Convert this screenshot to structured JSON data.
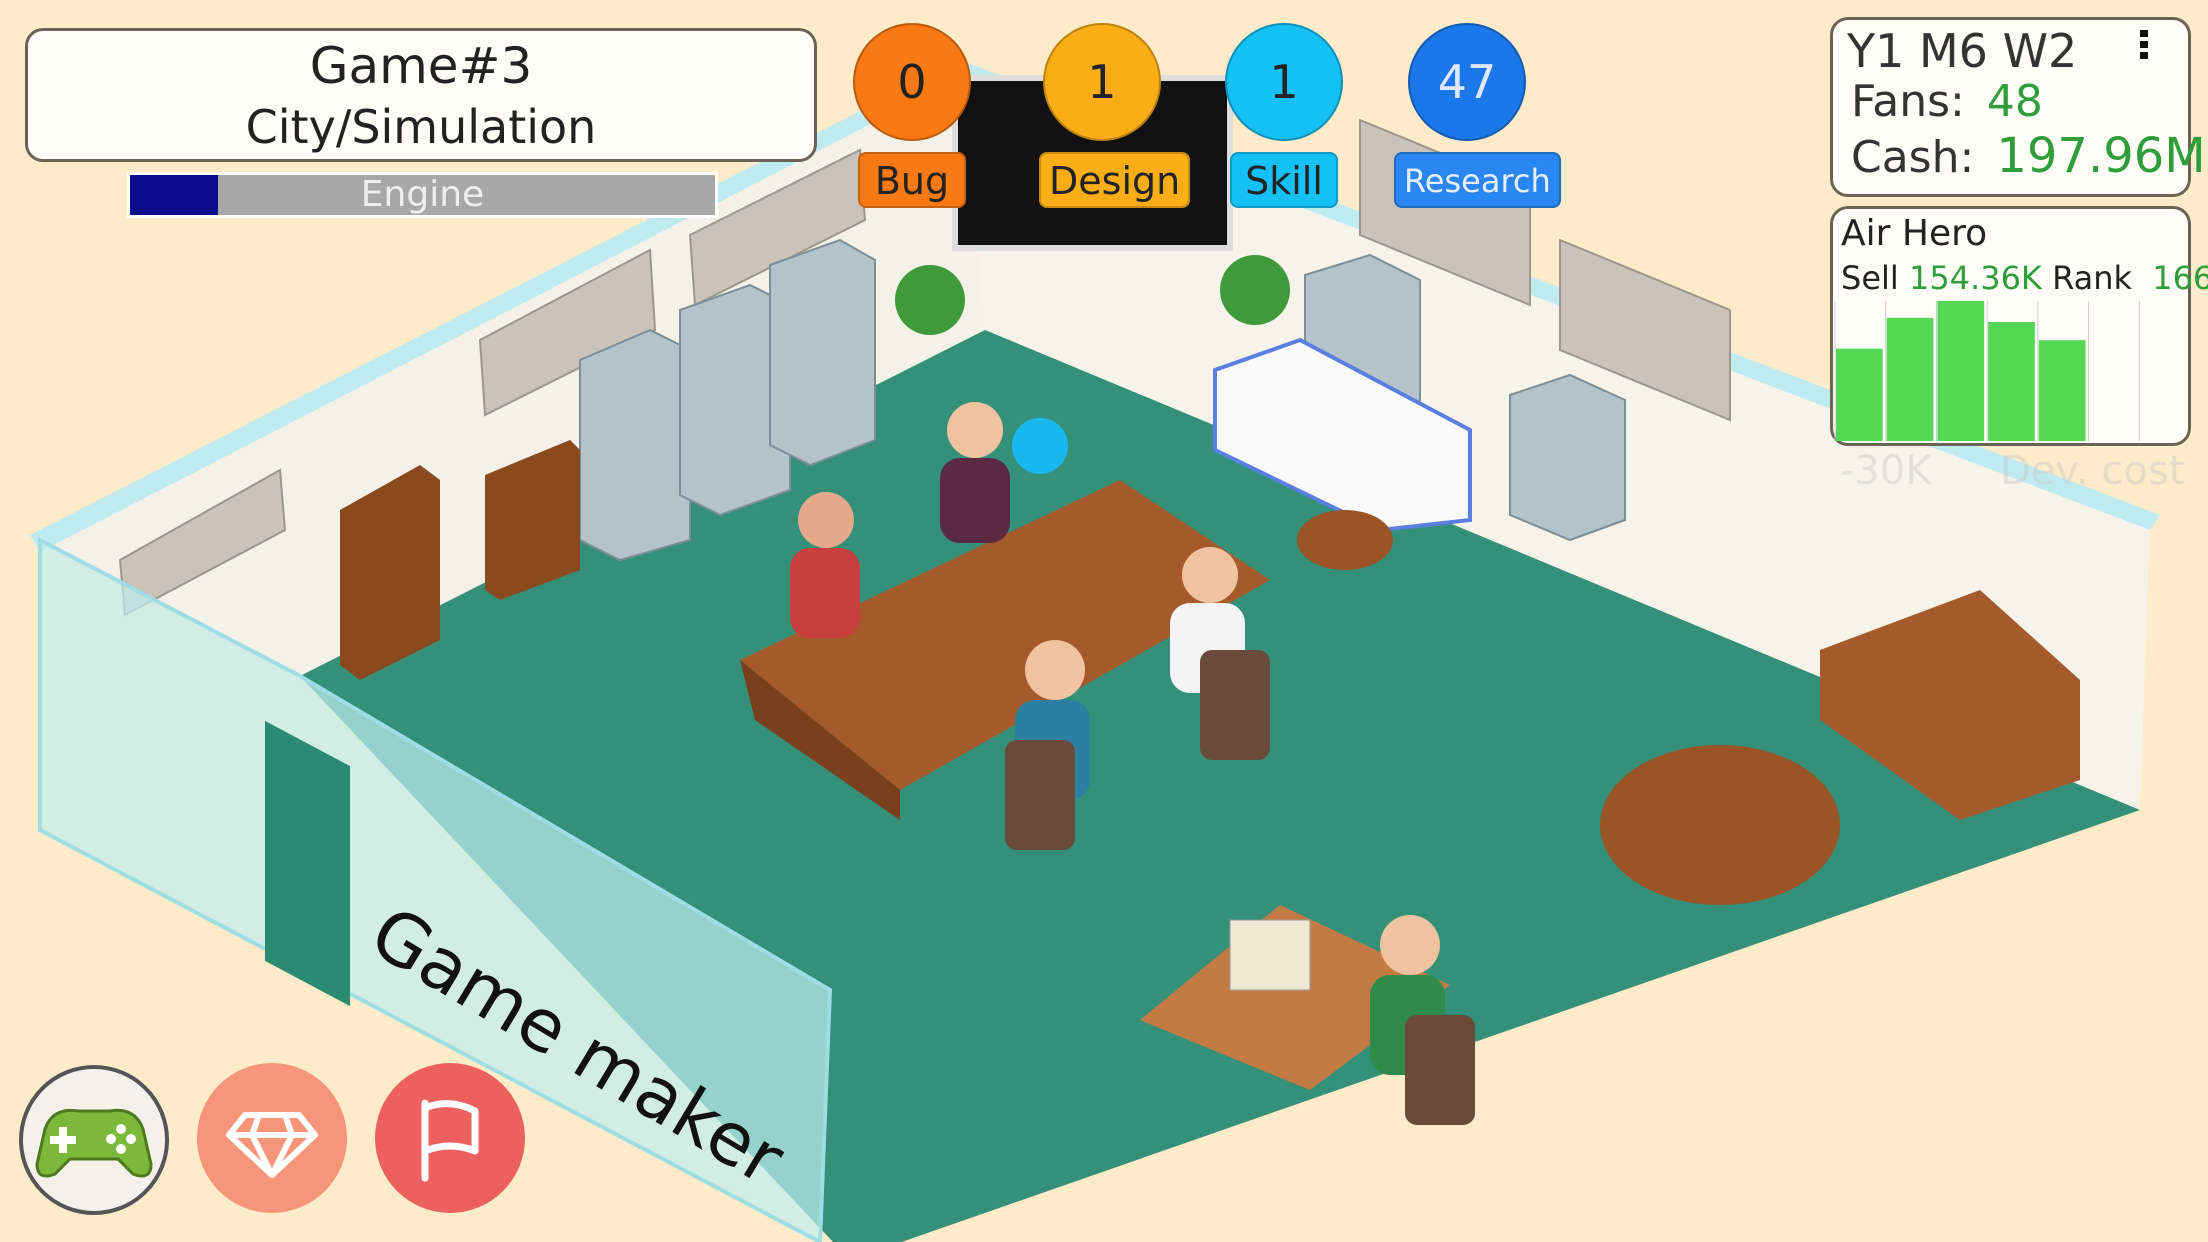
{
  "project": {
    "title": "Game#3",
    "genre": "City/Simulation",
    "phase_label": "Engine",
    "phase_progress_percent": 15
  },
  "stats_bubbles": [
    {
      "label": "Bug",
      "value": "0",
      "color": "#f97a14",
      "label_color": "#f97a14"
    },
    {
      "label": "Design",
      "value": "1",
      "color": "#fbad16",
      "label_color": "#fbad16"
    },
    {
      "label": "Skill",
      "value": "1",
      "color": "#15c0f5",
      "label_color": "#15c0f5"
    },
    {
      "label": "Research",
      "value": "47",
      "color": "#1b78ea",
      "label_color": "#2a86f0"
    }
  ],
  "status": {
    "date": "Y1 M6 W2",
    "fans_label": "Fans:",
    "fans": "48",
    "cash_label": "Cash:",
    "cash": "197.96M",
    "menu_icon": "more-vertical-icon"
  },
  "sales": {
    "game": "Air Hero",
    "sell_label": "Sell",
    "sell": "154.36K",
    "rank_label": "Rank",
    "rank": "166"
  },
  "chart_data": {
    "type": "bar",
    "categories": [
      "1",
      "2",
      "3",
      "4",
      "5",
      "6",
      "7"
    ],
    "values": [
      66,
      88,
      100,
      85,
      72,
      null,
      null
    ],
    "unit": "percent of peak week",
    "color": "#55d655",
    "grid": true
  },
  "faded_overlay": {
    "cost": "-30K",
    "cost_label": "Dev. cost"
  },
  "office_sign": "Game maker",
  "bottom_buttons": [
    {
      "name": "play-games-button",
      "icon": "gamepad-icon",
      "color": "#7cb83a"
    },
    {
      "name": "gems-button",
      "icon": "diamond-icon",
      "color": "#f7957a"
    },
    {
      "name": "goals-button",
      "icon": "flag-icon",
      "color": "#ec6060"
    }
  ],
  "colors": {
    "background": "#fdebc9",
    "floor": "#35907a",
    "positive": "#2f9e3a"
  }
}
